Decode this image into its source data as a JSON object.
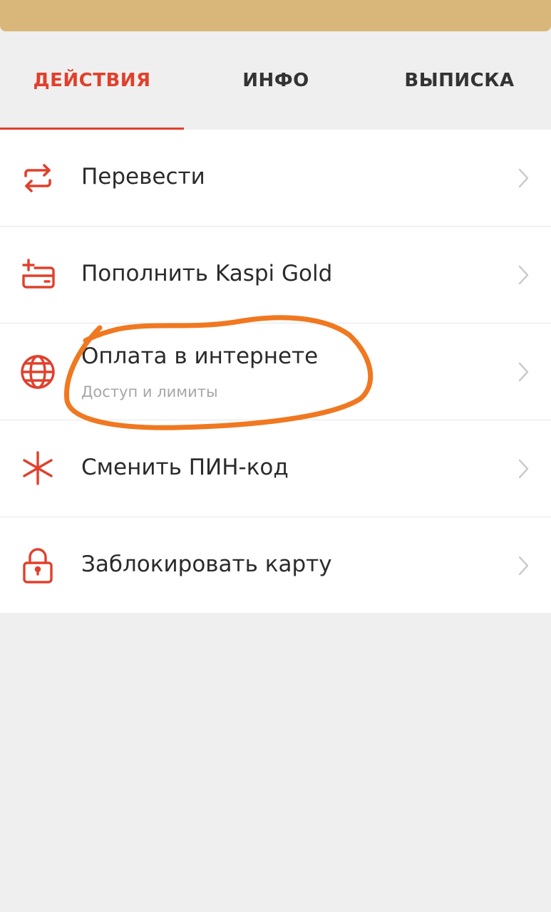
{
  "colors": {
    "accent": "#e0402c",
    "card": "#d9b77b",
    "annotation": "#f07820"
  },
  "tabs": [
    {
      "label": "ДЕЙСТВИЯ",
      "active": true
    },
    {
      "label": "ИНФО",
      "active": false
    },
    {
      "label": "ВЫПИСКА",
      "active": false
    }
  ],
  "actions": [
    {
      "label": "Перевести",
      "icon": "transfer-arrows-icon"
    },
    {
      "label": "Пополнить Kaspi Gold",
      "icon": "top-up-card-icon"
    },
    {
      "label": "Оплата в интернете",
      "sublabel": "Доступ и лимиты",
      "icon": "globe-icon"
    },
    {
      "label": "Сменить ПИН-код",
      "icon": "asterisk-icon"
    },
    {
      "label": "Заблокировать карту",
      "icon": "lock-icon"
    }
  ]
}
